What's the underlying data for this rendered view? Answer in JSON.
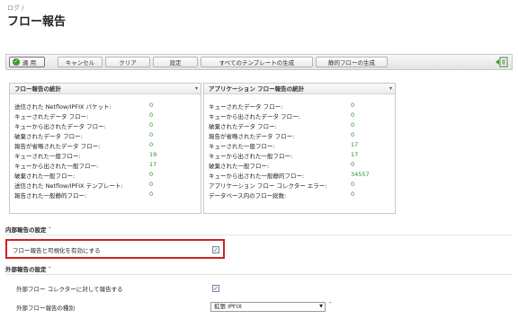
{
  "breadcrumb": "ログ /",
  "page_title": "フロー報告",
  "toolbar": {
    "apply": "適 用",
    "cancel": "キャンセル",
    "clear": "クリア",
    "settings": "設定",
    "generate_all_templates": "すべてのテンプレートの生成",
    "generate_static_flow": "静的フローの生成"
  },
  "left_panel": {
    "title": "フロー報告の統計",
    "rows": [
      {
        "label": "送信された Netflow/IPFIX パケット:",
        "value": "0"
      },
      {
        "label": "キューされたデータ フロー:",
        "value": "0"
      },
      {
        "label": "キューから出されたデータ フロー:",
        "value": "0"
      },
      {
        "label": "破棄されたデータ フロー:",
        "value": "0"
      },
      {
        "label": "報告が省略されたデータ フロー:",
        "value": "0"
      },
      {
        "label": "キューされた一般フロー:",
        "value": "19"
      },
      {
        "label": "キューから出された一般フロー:",
        "value": "17"
      },
      {
        "label": "破棄された一般フロー:",
        "value": "0"
      },
      {
        "label": "送信された Netflow/IPFIX テンプレート:",
        "value": "0"
      },
      {
        "label": "報告された一般静的フロー:",
        "value": "0"
      }
    ]
  },
  "right_panel": {
    "title": "アプリケーション フロー報告の統計",
    "rows": [
      {
        "label": "キューされたデータ フロー:",
        "value": "0"
      },
      {
        "label": "キューから出されたデータ フロー:",
        "value": "0"
      },
      {
        "label": "破棄されたデータ フロー:",
        "value": "0"
      },
      {
        "label": "報告が省略されたデータ フロー:",
        "value": "0"
      },
      {
        "label": "キューされた一般フロー:",
        "value": "17"
      },
      {
        "label": "キューから出された一般フロー:",
        "value": "17"
      },
      {
        "label": "破棄された一般フロー:",
        "value": "0"
      },
      {
        "label": "キューから出された一般静的フロー:",
        "value": "34557"
      },
      {
        "label": "アプリケーション フロー コレクター エラー:",
        "value": "0"
      },
      {
        "label": "データベース内のフロー総数:",
        "value": "0"
      }
    ]
  },
  "internal_section": {
    "title": "内部報告の設定",
    "enable_label": "フロー報告と可視化を有効にする",
    "enable_checked": true
  },
  "external_section": {
    "title": "外部報告の設定",
    "report_label": "外部フロー コレクターに対して報告する",
    "report_checked": true,
    "type_label": "外部フロー報告の種別",
    "type_value": "拡張 IPFIX"
  },
  "icons": {
    "apply": "check-icon",
    "toolbar_right": "export-icon",
    "panel_menu": "caret-down-icon"
  },
  "colors": {
    "value_green": "#2e8b2e",
    "highlight_red": "#d32020",
    "apply_green": "#3a9c2a"
  }
}
